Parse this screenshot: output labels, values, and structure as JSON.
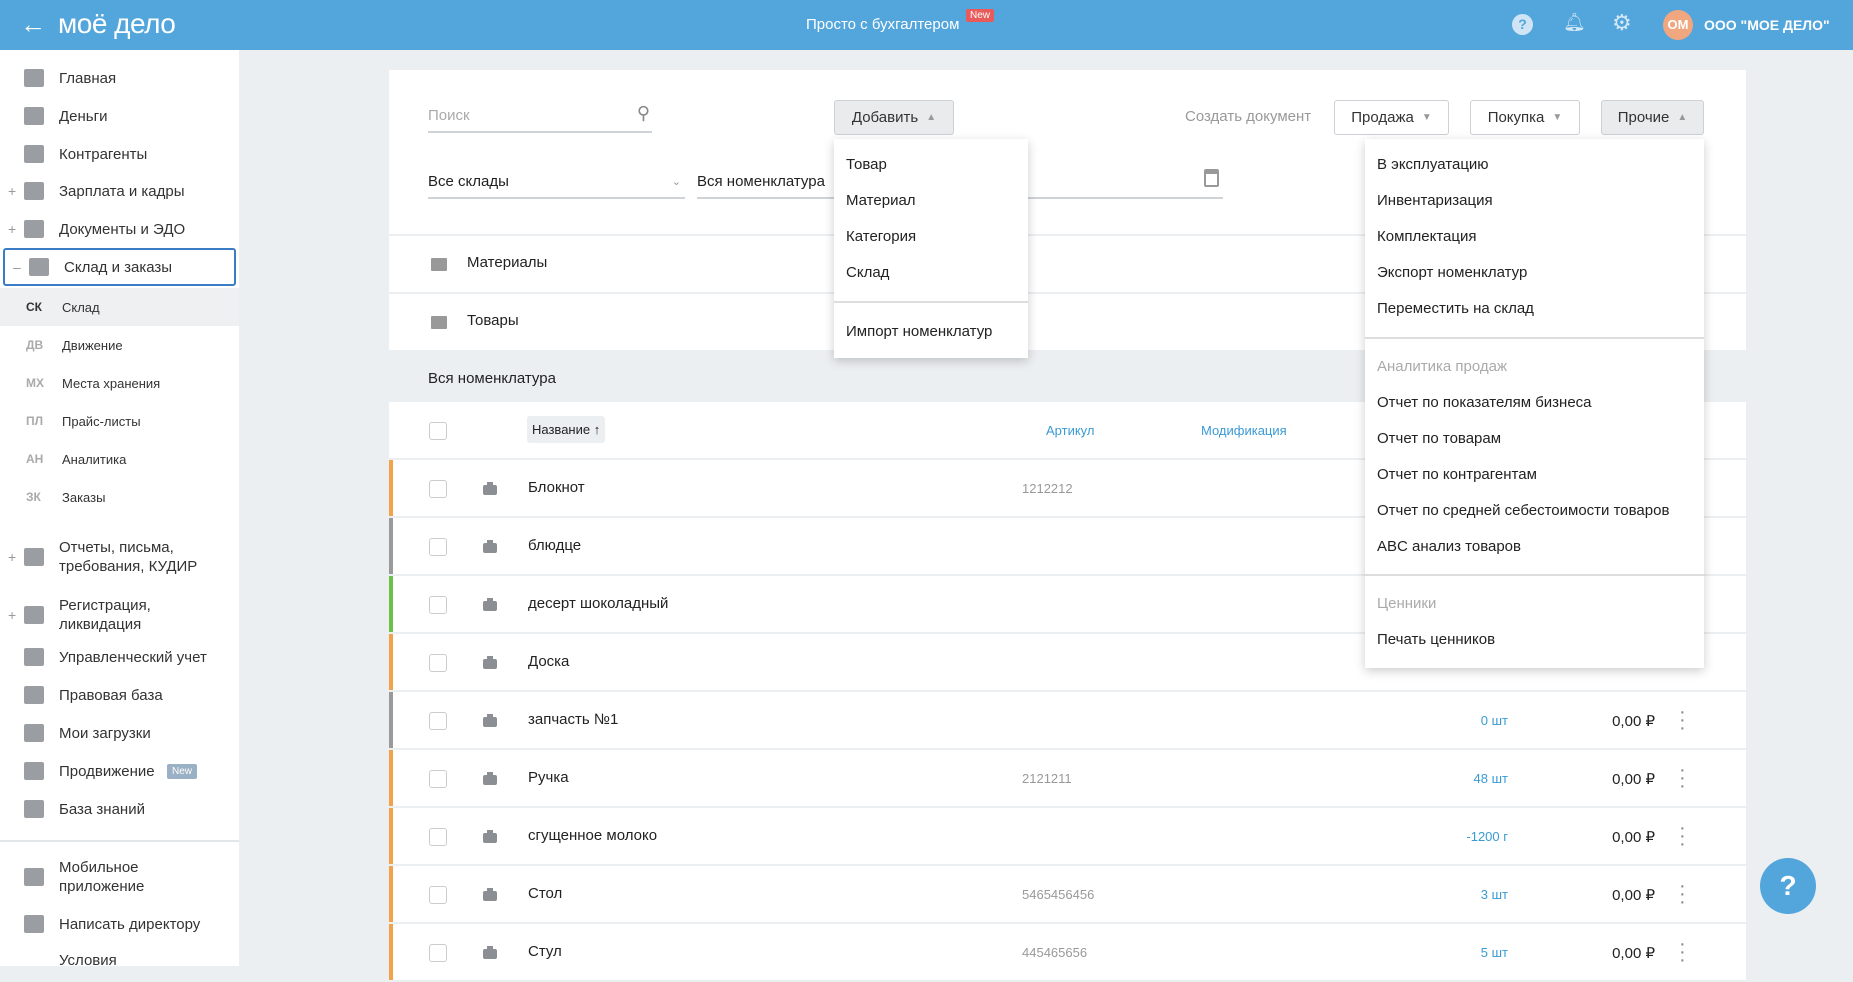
{
  "header": {
    "back_icon": "arrow-left-icon",
    "logo": "моё дело",
    "promo": "Просто с бухгалтером",
    "promo_badge": "New",
    "company_initials": "ОМ",
    "company": "ООО \"МОЕ ДЕЛО\"",
    "colors": {
      "header": "#52a6dc",
      "badge": "#e95a5a",
      "avatar": "#f0a77f"
    }
  },
  "sidebar": {
    "items": [
      {
        "label": "Главная",
        "icon": "home-icon"
      },
      {
        "label": "Деньги",
        "icon": "money-icon"
      },
      {
        "label": "Контрагенты",
        "icon": "contractors-icon"
      },
      {
        "label": "Зарплата и кадры",
        "icon": "salary-icon",
        "expand": "+"
      },
      {
        "label": "Документы и ЭДО",
        "icon": "folder-icon",
        "expand": "+"
      },
      {
        "label": "Склад и заказы",
        "icon": "warehouse-icon",
        "expand": "–"
      }
    ],
    "subitems": [
      {
        "abbr": "СК",
        "label": "Склад"
      },
      {
        "abbr": "ДВ",
        "label": "Движение"
      },
      {
        "abbr": "МХ",
        "label": "Места хранения"
      },
      {
        "abbr": "ПЛ",
        "label": "Прайс-листы"
      },
      {
        "abbr": "АН",
        "label": "Аналитика"
      },
      {
        "abbr": "ЗК",
        "label": "Заказы"
      }
    ],
    "items2": [
      {
        "label": "Отчеты, письма, требования, КУДИР",
        "icon": "reports-icon",
        "expand": "+"
      },
      {
        "label": "Регистрация, ликвидация",
        "icon": "registration-icon",
        "expand": "+"
      },
      {
        "label": "Управленческий учет",
        "icon": "management-icon"
      },
      {
        "label": "Правовая база",
        "icon": "briefcase-icon"
      },
      {
        "label": "Мои загрузки",
        "icon": "folder-icon"
      },
      {
        "label": "Продвижение",
        "icon": "chart-icon",
        "badge": "New"
      },
      {
        "label": "База знаний",
        "icon": "graduation-cap-icon"
      }
    ],
    "bottom": [
      {
        "label": "Мобильное приложение",
        "icon": "mobile-icon"
      },
      {
        "label": "Написать директору",
        "icon": "chat-icon"
      },
      {
        "label": "Условия",
        "icon": ""
      }
    ]
  },
  "toolbar": {
    "search_placeholder": "Поиск",
    "add_label": "Добавить",
    "create_doc_label": "Создать документ",
    "sale_label": "Продажа",
    "purchase_label": "Покупка",
    "other_label": "Прочие"
  },
  "filters": {
    "warehouse": "Все склады",
    "nomenclature": "Вся номенклатура"
  },
  "add_menu": {
    "items": [
      "Товар",
      "Материал",
      "Категория",
      "Склад"
    ],
    "import": "Импорт номенклатур"
  },
  "other_menu": {
    "items": [
      "В эксплуатацию",
      "Инвентаризация",
      "Комплектация",
      "Экспорт номенклатур",
      "Переместить на склад"
    ],
    "analytics_header": "Аналитика продаж",
    "analytics": [
      "Отчет по показателям бизнеса",
      "Отчет по товарам",
      "Отчет по контрагентам",
      "Отчет по средней себестоимости товаров",
      "ABC анализ товаров"
    ],
    "tags_header": "Ценники",
    "tags": [
      "Печать ценников"
    ]
  },
  "folders": [
    "Материалы",
    "Товары"
  ],
  "section_title": "Вся номенклатура",
  "table": {
    "columns": {
      "name": "Название ↑",
      "sku": "Артикул",
      "modification": "Модификация"
    },
    "rows": [
      {
        "name": "Блокнот",
        "sku": "1212212",
        "qty": null,
        "price": null,
        "color": "#f5a04a"
      },
      {
        "name": "блюдце",
        "sku": "",
        "qty": null,
        "price": null,
        "color": "#9a9a9a"
      },
      {
        "name": "десерт шоколадный",
        "sku": "",
        "qty": null,
        "price": null,
        "color": "#6cc04a"
      },
      {
        "name": "Доска",
        "sku": "",
        "qty": null,
        "price": null,
        "color": "#f5a04a"
      },
      {
        "name": "запчасть №1",
        "sku": "",
        "qty": "0 шт",
        "price": "0,00 ₽",
        "color": "#9a9a9a"
      },
      {
        "name": "Ручка",
        "sku": "2121211",
        "qty": "48 шт",
        "price": "0,00 ₽",
        "color": "#f5a04a"
      },
      {
        "name": "сгущенное молоко",
        "sku": "",
        "qty": "-1200 г",
        "price": "0,00 ₽",
        "color": "#f5a04a"
      },
      {
        "name": "Стол",
        "sku": "5465456456",
        "qty": "3 шт",
        "price": "0,00 ₽",
        "color": "#f5a04a"
      },
      {
        "name": "Стул",
        "sku": "445465656",
        "qty": "5 шт",
        "price": "0,00 ₽",
        "color": "#f5a04a"
      }
    ]
  },
  "help_fab": "?"
}
